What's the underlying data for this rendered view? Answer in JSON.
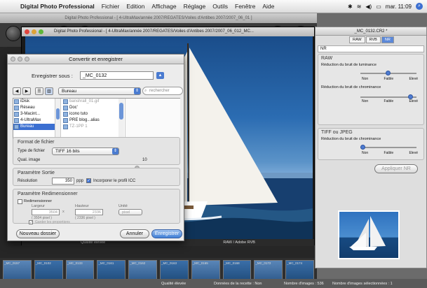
{
  "menubar": {
    "app_name": "Digital Photo Professional",
    "menus": [
      "Fichier",
      "Edition",
      "Affichage",
      "Réglage",
      "Outils",
      "Fenêtre",
      "Aide"
    ],
    "clock": "mar. 11:09",
    "apple_glyph": "",
    "status_icons": [
      "bluetooth-icon",
      "wifi-icon",
      "volume-icon",
      "battery-icon",
      "spotlight-icon"
    ]
  },
  "main_window": {
    "title": "Digital Photo Professional - [ 4-UltraMax/année 2007/REGATES/Voiles d'Antibes 2007/2007_06_01 ]"
  },
  "viewer": {
    "title": "Digital Photo Professional - [ 4-UltraMax/année 2007/REGATES/Voiles d'Antibes 2007/2007_06_012_MC...",
    "status_quality": "Qualité élevée",
    "status_format": "RAW / Adobe RVB"
  },
  "dialog": {
    "title": "Convertir et enregistrer",
    "save_as_label": "Enregistrer sous :",
    "filename": "_MC_0132",
    "location": "Bureau",
    "search_placeholder": "rechercher",
    "volumes": [
      "iDisk",
      "Réseau",
      "3-Macint...",
      "4-UltraMax",
      "Bureau"
    ],
    "files": [
      {
        "name": "banshrall_01.gif",
        "dim": true
      },
      {
        "name": "Doc'",
        "dim": false
      },
      {
        "name": "icono tuto",
        "dim": false
      },
      {
        "name": "PRE blog...alias",
        "dim": false
      },
      {
        "name": "TZ-1PP 1",
        "dim": true
      }
    ],
    "format_section": "Format de fichier",
    "file_type_label": "Type de fichier",
    "file_type_value": "TIFF 16 bits",
    "quality_label": "Qual. image",
    "quality_value": "10",
    "output_section": "Paramètre Sortie",
    "resolution_label": "Résolution",
    "resolution_value": "350",
    "resolution_unit": "ppp",
    "icc_label": "Incorporer le profil ICC",
    "icc_checked": true,
    "resize_section": "Paramètre Redimensionner",
    "resize_label": "Redimensionner",
    "width_label": "Largeur",
    "height_label": "Hauteur",
    "unit_label": "Unité",
    "width_value": "3504",
    "height_value": "2336",
    "unit_value": "pixel",
    "width_px": "( 3504 pixel )",
    "height_px": "( 2336 pixel )",
    "keep_proportions_label": "Garder les proportions",
    "new_folder_button": "Nouveau dossier",
    "cancel_button": "Annuler",
    "save_button": "Enregistrer"
  },
  "palette": {
    "title": "_MC_0132.CR2 *",
    "tabs": [
      "RAW",
      "RVB",
      "NR"
    ],
    "active_tab": "NR",
    "nr_label": "NR",
    "raw_section": "RAW",
    "raw_lum_label": "Réduction du bruit de luminance",
    "raw_chroma_label": "Réduction du bruit de chrominance",
    "scale_labels": [
      "Non",
      "Faible",
      "Elevé"
    ],
    "tiff_section": "TIFF ou JPEG",
    "tiff_chroma_label": "Réduction du bruit de chrominance",
    "apply_button": "Appliquer NR"
  },
  "filmstrip": {
    "captions": [
      "_MC_0157",
      "_MC_0102",
      "_MC_0133",
      "_MC_0161",
      "_MC_0162",
      "_MC_0163",
      "_MC_0165",
      "_MC_0168",
      "_MC_0172",
      "_MC_0174"
    ]
  },
  "statusbar": {
    "quality": "Qualité élevée",
    "recipe": "Données de la recette : Non",
    "count": "Nombre d'images : 536",
    "selected": "Nombre d'images sélectionnées : 1"
  },
  "colors": {
    "accent": "#3b6fd1",
    "sky": "#2b6cb2",
    "sea": "#143f6e"
  }
}
